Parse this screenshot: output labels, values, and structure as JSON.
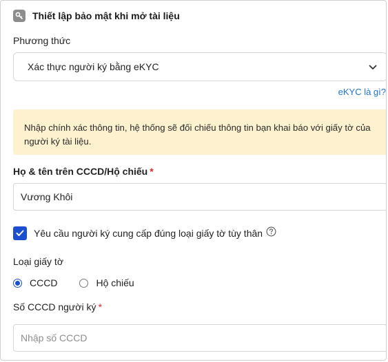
{
  "header": {
    "title": "Thiết lập bảo mật khi mở tài liệu",
    "icon": "key-icon"
  },
  "method": {
    "label": "Phương thức",
    "selected": "Xác thực người ký bằng eKYC",
    "help_link": "eKYC là gì?"
  },
  "alert": {
    "text": "Nhập chính xác thông tin, hệ thống sẽ đối chiếu thông tin bạn khai báo với giấy tờ của người ký tài liệu.",
    "color": "#fdf1cf"
  },
  "fullname": {
    "label": "Họ & tên trên CCCD/Hộ chiếu",
    "required_mark": "*",
    "value": "Vương Khôi"
  },
  "require_id": {
    "label": "Yêu cầu người ký cung cấp đúng loại giấy tờ tùy thân",
    "checked": true
  },
  "doc_type": {
    "label": "Loại giấy tờ",
    "options": [
      "CCCD",
      "Hộ chiếu"
    ],
    "selected": "CCCD"
  },
  "id_number": {
    "label": "Số CCCD người ký",
    "required_mark": "*",
    "placeholder": "Nhập số CCCD",
    "value": ""
  },
  "colors": {
    "accent": "#1a4fd0",
    "link": "#1e73d6",
    "required": "#e02424"
  }
}
